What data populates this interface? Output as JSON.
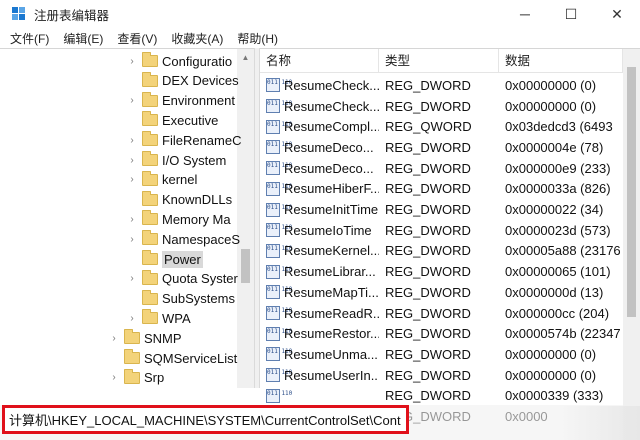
{
  "window": {
    "title": "注册表编辑器",
    "controls": [
      "─",
      "☐",
      "✕"
    ]
  },
  "menu": [
    "文件(F)",
    "编辑(E)",
    "查看(V)",
    "收藏夹(A)",
    "帮助(H)"
  ],
  "tree": {
    "items": [
      {
        "label": "Configuratio",
        "expander": "›",
        "level": 2
      },
      {
        "label": "DEX Devices",
        "expander": "",
        "level": 2
      },
      {
        "label": "Environment",
        "expander": "›",
        "level": 2
      },
      {
        "label": "Executive",
        "expander": "",
        "level": 2
      },
      {
        "label": "FileRenameC",
        "expander": "›",
        "level": 2
      },
      {
        "label": "I/O System",
        "expander": "›",
        "level": 2
      },
      {
        "label": "kernel",
        "expander": "›",
        "level": 2
      },
      {
        "label": "KnownDLLs",
        "expander": "",
        "level": 2
      },
      {
        "label": "Memory Ma",
        "expander": "›",
        "level": 2
      },
      {
        "label": "NamespaceS",
        "expander": "›",
        "level": 2
      },
      {
        "label": "Power",
        "expander": "",
        "level": 2,
        "selected": true
      },
      {
        "label": "Quota Syster",
        "expander": "›",
        "level": 2
      },
      {
        "label": "SubSystems",
        "expander": "",
        "level": 2
      },
      {
        "label": "WPA",
        "expander": "›",
        "level": 2
      },
      {
        "label": "SNMP",
        "expander": "›",
        "level": 1
      },
      {
        "label": "SQMServiceList",
        "expander": "",
        "level": 1
      },
      {
        "label": "Srp",
        "expander": "›",
        "level": 1
      }
    ]
  },
  "list": {
    "headers": {
      "name": "名称",
      "type": "类型",
      "data": "数据"
    },
    "icon_text": "011\n110",
    "rows": [
      {
        "name": "ResumeCheck...",
        "type": "REG_DWORD",
        "data": "0x00000000 (0)"
      },
      {
        "name": "ResumeCheck...",
        "type": "REG_DWORD",
        "data": "0x00000000 (0)"
      },
      {
        "name": "ResumeCompl...",
        "type": "REG_QWORD",
        "data": "0x03dedcd3 (6493"
      },
      {
        "name": "ResumeDeco...",
        "type": "REG_DWORD",
        "data": "0x0000004e (78)"
      },
      {
        "name": "ResumeDeco...",
        "type": "REG_DWORD",
        "data": "0x000000e9 (233)"
      },
      {
        "name": "ResumeHiberF...",
        "type": "REG_DWORD",
        "data": "0x0000033a (826)"
      },
      {
        "name": "ResumeInitTime",
        "type": "REG_DWORD",
        "data": "0x00000022 (34)"
      },
      {
        "name": "ResumeIoTime",
        "type": "REG_DWORD",
        "data": "0x0000023d (573)"
      },
      {
        "name": "ResumeKernel...",
        "type": "REG_DWORD",
        "data": "0x00005a88 (23176"
      },
      {
        "name": "ResumeLibrar...",
        "type": "REG_DWORD",
        "data": "0x00000065 (101)"
      },
      {
        "name": "ResumeMapTi...",
        "type": "REG_DWORD",
        "data": "0x0000000d (13)"
      },
      {
        "name": "ResumeReadR...",
        "type": "REG_DWORD",
        "data": "0x000000cc (204)"
      },
      {
        "name": "ResumeRestor...",
        "type": "REG_DWORD",
        "data": "0x0000574b (22347"
      },
      {
        "name": "ResumeUnma...",
        "type": "REG_DWORD",
        "data": "0x00000000 (0)"
      },
      {
        "name": "ResumeUserIn...",
        "type": "REG_DWORD",
        "data": "0x00000000 (0)"
      },
      {
        "name": "",
        "type": "REG_DWORD",
        "data": "0x0000339 (333)"
      },
      {
        "name": "",
        "type": "REG_DWORD",
        "data": "0x0000"
      }
    ]
  },
  "statusbar": {
    "path": "计算机\\HKEY_LOCAL_MACHINE\\SYSTEM\\CurrentControlSet\\Cont"
  }
}
